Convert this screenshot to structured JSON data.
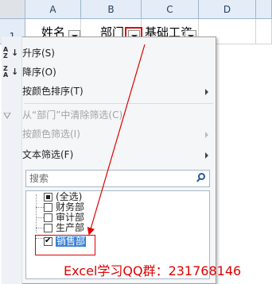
{
  "sheet": {
    "columns": [
      "A",
      "B",
      "C",
      "D"
    ],
    "row_number": "1",
    "header_cells": [
      "姓名",
      "部门",
      "基础工资"
    ]
  },
  "filter_menu": {
    "sort_asc": "升序(S)",
    "sort_desc": "降序(O)",
    "sort_by_color": "按颜色排序(T)",
    "clear_filter": "从“部门”中清除筛选(C)",
    "filter_by_color": "按颜色筛选(I)",
    "text_filter": "文本筛选(F)",
    "search_placeholder": "搜索",
    "items": [
      {
        "label": "(全选)",
        "state": "partial"
      },
      {
        "label": "财务部",
        "state": "unchecked"
      },
      {
        "label": "审计部",
        "state": "unchecked"
      },
      {
        "label": "生产部",
        "state": "unchecked"
      },
      {
        "label": "销售部",
        "state": "checked"
      }
    ]
  },
  "watermark": "Excel学习QQ群：231768146",
  "colors": {
    "annotation_red": "#e00000",
    "menu_bg": "#f5f6f7",
    "header_bg": "#e4ecf7",
    "selection_blue": "#3c7fd5"
  },
  "icons": [
    "sort-asc-icon",
    "sort-desc-icon",
    "clear-filter-icon",
    "search-icon",
    "dropdown-arrow-icon",
    "submenu-arrow-icon"
  ]
}
